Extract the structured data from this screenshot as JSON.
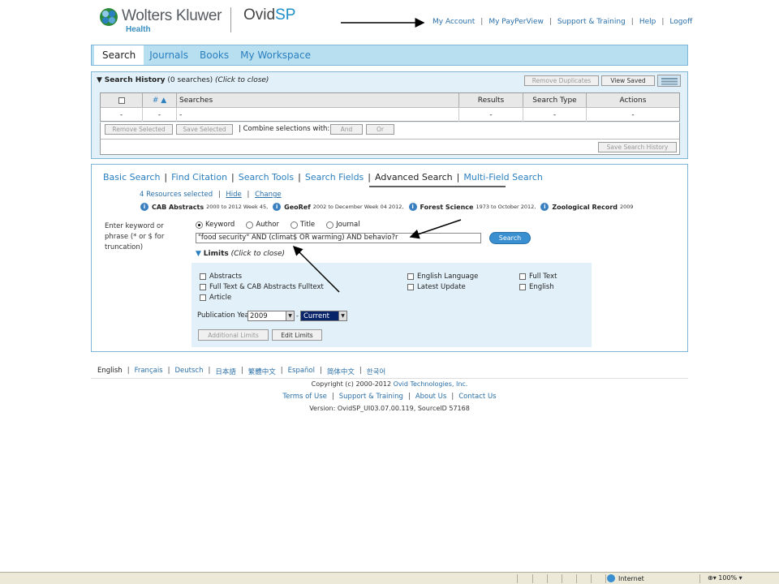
{
  "header": {
    "brand": "Wolters Kluwer",
    "brand_sub": "Health",
    "product_main": "Ovid",
    "product_sp": "SP",
    "nav": [
      "My Account",
      "My PayPerView",
      "Support & Training",
      "Help",
      "Logoff"
    ]
  },
  "main_tabs": [
    "Search",
    "Journals",
    "Books",
    "My Workspace"
  ],
  "history": {
    "title": "Search History",
    "count": "(0 searches)",
    "hint": "(Click to close)",
    "remove_duplicates": "Remove Duplicates",
    "view_saved": "View Saved",
    "columns": [
      "#",
      "Searches",
      "Results",
      "Search Type",
      "Actions"
    ],
    "sort_indicator": "▲",
    "row": [
      "-",
      "-",
      "-",
      "-",
      "-",
      "-"
    ],
    "remove_selected": "Remove Selected",
    "save_selected": "Save Selected",
    "combine_label": "| Combine selections with:",
    "and": "And",
    "or": "Or",
    "save_history": "Save Search History"
  },
  "search": {
    "tabs": [
      "Basic Search",
      "Find Citation",
      "Search Tools",
      "Search Fields",
      "Advanced Search",
      "Multi-Field Search"
    ],
    "resources_selected": "4 Resources selected",
    "hide": "Hide",
    "change": "Change",
    "resources": [
      {
        "name": "CAB Abstracts",
        "range": "2000 to 2012 Week 45,"
      },
      {
        "name": "GeoRef",
        "range": "2002 to December Week 04 2012,"
      },
      {
        "name": "Forest Science",
        "range": "1973 to October 2012,"
      },
      {
        "name": "Zoological Record",
        "range": "2009"
      }
    ],
    "enter_label": "Enter keyword or phrase (* or $ for truncation)",
    "radio_options": [
      "Keyword",
      "Author",
      "Title",
      "Journal"
    ],
    "selected_option": "Keyword",
    "query": "\"food security\" AND (climat$ OR warming) AND behavio?r",
    "search_button": "Search",
    "limits_title": "Limits",
    "limits_hint": "(Click to close)",
    "limits_col1": [
      "Abstracts",
      "Full Text & CAB Abstracts Fulltext",
      "Article"
    ],
    "limits_col2": [
      "English Language",
      "Latest Update"
    ],
    "limits_col3": [
      "Full Text",
      "English"
    ],
    "pub_year_label": "Publication Year",
    "pub_year_from": "2009",
    "pub_year_to": "Current",
    "additional_limits": "Additional Limits",
    "edit_limits": "Edit Limits"
  },
  "footer": {
    "languages": [
      "English",
      "Français",
      "Deutsch",
      "日本語",
      "繁體中文",
      "Español",
      "简体中文",
      "한국어"
    ],
    "copyright_prefix": "Copyright (c) 2000-2012",
    "copyright_owner": "Ovid Technologies, Inc.",
    "links": [
      "Terms of Use",
      "Support & Training",
      "About Us",
      "Contact Us"
    ],
    "version": "Version: OvidSP_UI03.07.00.119, SourceID 57168"
  },
  "status_bar": {
    "zone": "Internet",
    "zoom": "100%"
  },
  "colors": {
    "link": "#2a7fc0",
    "panel_bg": "#e2f1f9",
    "tab_bar": "#b8dff0",
    "search_button": "#3a8fd0"
  }
}
